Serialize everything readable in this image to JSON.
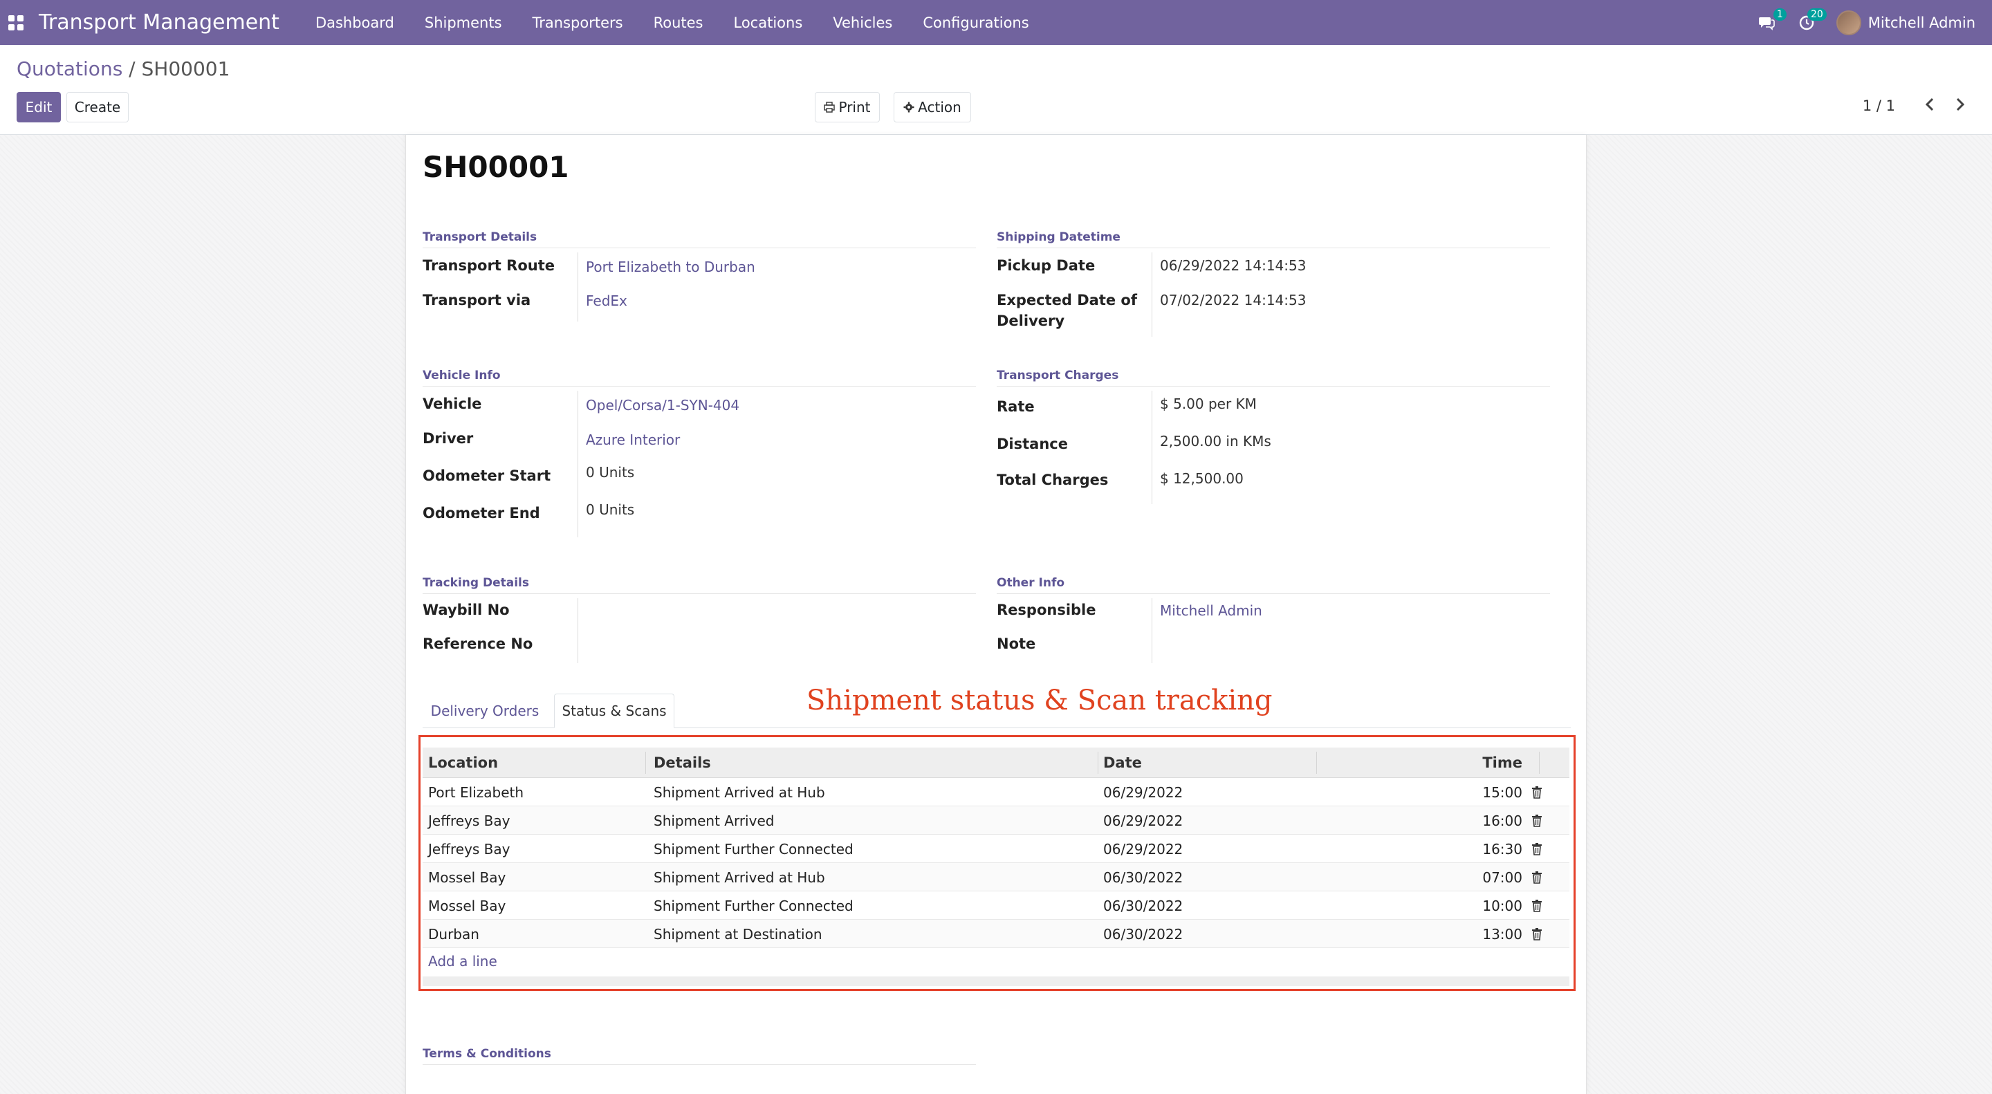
{
  "navbar": {
    "app_title": "Transport Management",
    "menu": [
      "Dashboard",
      "Shipments",
      "Transporters",
      "Routes",
      "Locations",
      "Vehicles",
      "Configurations"
    ],
    "messages_count": "1",
    "activities_count": "20",
    "user_name": "Mitchell Admin",
    "bg_color": "#71639e"
  },
  "breadcrumb": {
    "parent": "Quotations",
    "separator": " / ",
    "current": "SH00001"
  },
  "buttons": {
    "edit": "Edit",
    "create": "Create",
    "print": "Print",
    "action": "Action"
  },
  "pager": {
    "value": "1 / 1"
  },
  "record": {
    "name": "SH00001"
  },
  "transport_details": {
    "title": "Transport Details",
    "route_label": "Transport Route",
    "route_value": "Port Elizabeth to Durban",
    "via_label": "Transport via",
    "via_value": "FedEx"
  },
  "shipping_datetime": {
    "title": "Shipping Datetime",
    "pickup_label": "Pickup Date",
    "pickup_value": "06/29/2022 14:14:53",
    "delivery_label_1": "Expected Date of",
    "delivery_label_2": "Delivery",
    "delivery_value": "07/02/2022 14:14:53"
  },
  "vehicle_info": {
    "title": "Vehicle Info",
    "vehicle_label": "Vehicle",
    "vehicle_value": "Opel/Corsa/1-SYN-404",
    "driver_label": "Driver",
    "driver_value": "Azure Interior",
    "odo_start_label": "Odometer Start",
    "odo_start_value": "0 Units",
    "odo_end_label": "Odometer End",
    "odo_end_value": "0 Units"
  },
  "transport_charges": {
    "title": "Transport Charges",
    "rate_label": "Rate",
    "rate_value": "$ 5.00 per KM",
    "distance_label": "Distance",
    "distance_value": "2,500.00 in KMs",
    "total_label": "Total Charges",
    "total_value": "$ 12,500.00"
  },
  "tracking_details": {
    "title": "Tracking Details",
    "waybill_label": "Waybill No",
    "reference_label": "Reference No"
  },
  "other_info": {
    "title": "Other Info",
    "responsible_label": "Responsible",
    "responsible_value": "Mitchell Admin",
    "note_label": "Note"
  },
  "tabs": [
    "Delivery Orders",
    "Status & Scans"
  ],
  "active_tab": "Status & Scans",
  "annotation": "Shipment status & Scan tracking",
  "scans_table": {
    "columns": [
      "Location",
      "Details",
      "Date",
      "Time"
    ],
    "rows": [
      [
        "Port Elizabeth",
        "Shipment Arrived at Hub",
        "06/29/2022",
        "15:00"
      ],
      [
        "Jeffreys Bay",
        "Shipment Arrived",
        "06/29/2022",
        "16:00"
      ],
      [
        "Jeffreys Bay",
        "Shipment Further Connected",
        "06/29/2022",
        "16:30"
      ],
      [
        "Mossel Bay",
        "Shipment Arrived at Hub",
        "06/30/2022",
        "07:00"
      ],
      [
        "Mossel Bay",
        "Shipment Further Connected",
        "06/30/2022",
        "10:00"
      ],
      [
        "Durban",
        "Shipment at Destination",
        "06/30/2022",
        "13:00"
      ]
    ],
    "add_line": "Add a line"
  },
  "terms": {
    "title": "Terms & Conditions"
  }
}
